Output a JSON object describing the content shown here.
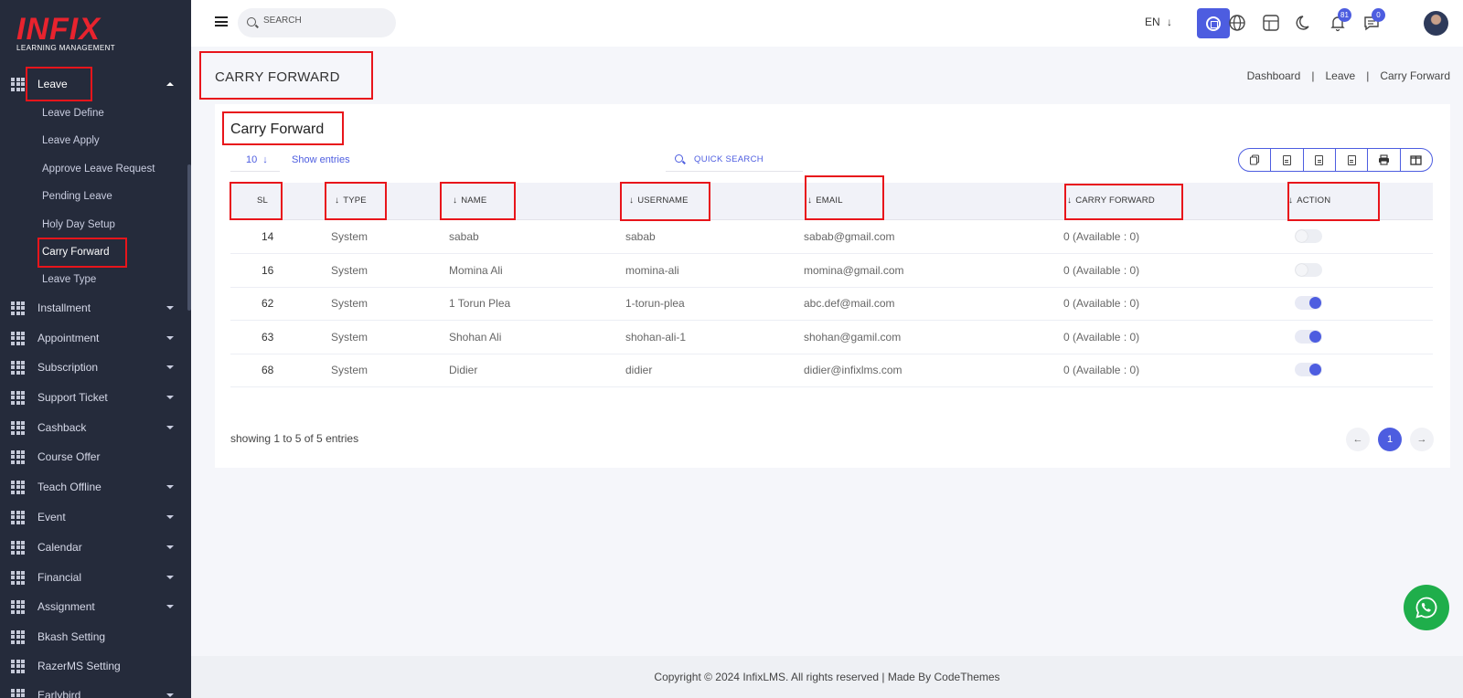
{
  "brand": {
    "logo_text": "INFIX",
    "logo_subtext": "LEARNING MANAGEMENT"
  },
  "sidebar": {
    "active_menu": "Leave",
    "submenu": [
      "Leave Define",
      "Leave Apply",
      "Approve Leave Request",
      "Pending Leave",
      "Holy Day Setup",
      "Carry Forward",
      "Leave Type"
    ],
    "menu": [
      "Installment",
      "Appointment",
      "Subscription",
      "Support Ticket",
      "Cashback",
      "Course Offer",
      "Teach Offline",
      "Event",
      "Calendar",
      "Financial",
      "Assignment",
      "Bkash Setting",
      "RazerMS Setting",
      "Earlybird"
    ]
  },
  "topbar": {
    "search_placeholder": "SEARCH",
    "language": "EN",
    "notifications_count": "81",
    "messages_count": "0"
  },
  "page": {
    "title": "CARRY FORWARD",
    "breadcrumb": [
      "Dashboard",
      "Leave",
      "Carry Forward"
    ]
  },
  "card": {
    "title": "Carry Forward",
    "entries_value": "10",
    "show_entries": "Show entries",
    "quick_search": "QUICK SEARCH",
    "columns": [
      "SL",
      "TYPE",
      "NAME",
      "USERNAME",
      "EMAIL",
      "CARRY FORWARD",
      "ACTION"
    ],
    "rows": [
      {
        "sl": "14",
        "type": "System",
        "name": "sabab",
        "username": "sabab",
        "email": "sabab@gmail.com",
        "carry": "0 (Available : 0)",
        "active": false
      },
      {
        "sl": "16",
        "type": "System",
        "name": "Momina Ali",
        "username": "momina-ali",
        "email": "momina@gmail.com",
        "carry": "0 (Available : 0)",
        "active": false
      },
      {
        "sl": "62",
        "type": "System",
        "name": "1 Torun Plea",
        "username": "1-torun-plea",
        "email": "abc.def@mail.com",
        "carry": "0 (Available : 0)",
        "active": true
      },
      {
        "sl": "63",
        "type": "System",
        "name": "Shohan Ali",
        "username": "shohan-ali-1",
        "email": "shohan@gamil.com",
        "carry": "0 (Available : 0)",
        "active": true
      },
      {
        "sl": "68",
        "type": "System",
        "name": "Didier",
        "username": "didier",
        "email": "didier@infixlms.com",
        "carry": "0 (Available : 0)",
        "active": true
      }
    ],
    "showing": "showing 1 to 5 of 5 entries",
    "current_page": "1"
  },
  "footer": {
    "text": "Copyright © 2024 InfixLMS. All rights reserved | Made By CodeThemes"
  },
  "colors": {
    "accent": "#4d5de0",
    "sidebar_bg": "#252b3b",
    "highlight": "#e8151b",
    "whatsapp": "#1fae4b"
  }
}
